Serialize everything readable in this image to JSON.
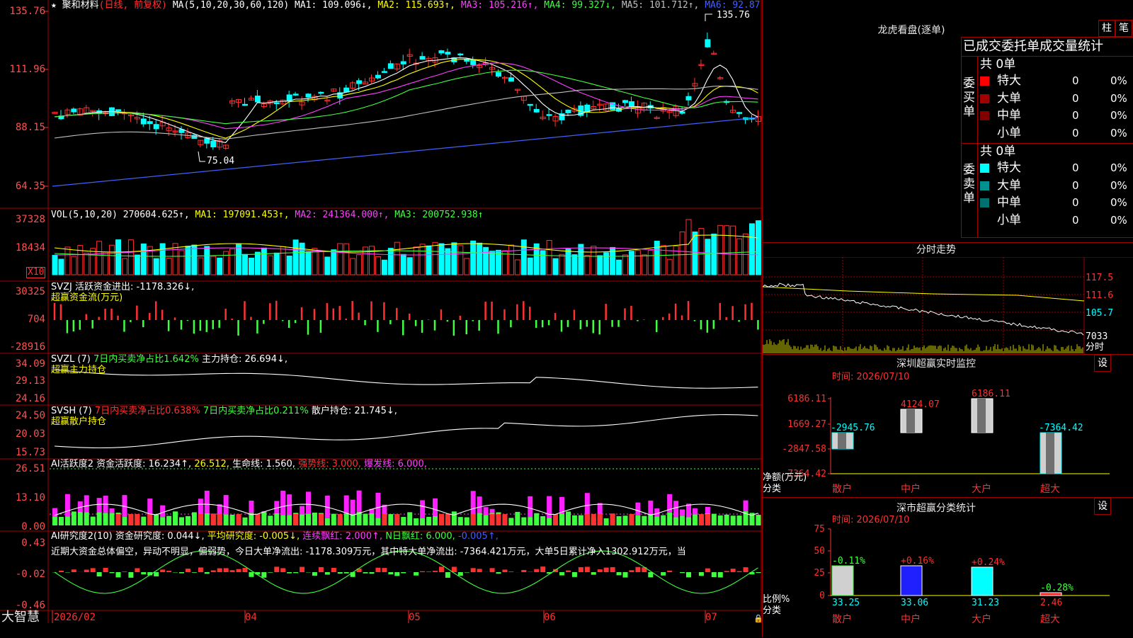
{
  "main": {
    "stock_name": "聚和材料",
    "period": "(日线, 前复权)",
    "ma_label": "MA(5,10,20,30,60,120)",
    "ma_items": [
      {
        "text": "MA1: 109.096↓,",
        "color": "#ffffff"
      },
      {
        "text": "MA2: 115.693↑,",
        "color": "#ffff00"
      },
      {
        "text": "MA3: 105.216↑,",
        "color": "#ff40ff"
      },
      {
        "text": "MA4: 99.327↓,",
        "color": "#40ff40"
      },
      {
        "text": "MA5: 101.712↑,",
        "color": "#c0c0c0"
      },
      {
        "text": "MA6: 92.87",
        "color": "#4060ff"
      }
    ],
    "y_labels": [
      "135.76",
      "111.96",
      "88.15",
      "64.35"
    ],
    "high_marker": "135.76",
    "low_marker": "75.04"
  },
  "vol": {
    "title": "VOL(5,10,20)",
    "value": "270604.625↑,",
    "ma_items": [
      {
        "text": "MA1: 197091.453↑,",
        "color": "#ffff00"
      },
      {
        "text": "MA2: 241364.000↑,",
        "color": "#ff40ff"
      },
      {
        "text": "MA3: 200752.938↑",
        "color": "#40ff40"
      }
    ],
    "y_labels": [
      "37328",
      "18434"
    ],
    "unit": "X10"
  },
  "svzj": {
    "title": "SVZJ  活跃资金进出: -1178.326↓,",
    "subtitle": "超赢资金流(万元)",
    "y_labels": [
      "30325",
      "704",
      "-28916"
    ]
  },
  "svzl": {
    "title_a": "SVZL (7)",
    "title_b": "7日内买卖净占比1.642%",
    "title_c": "主力持仓: 26.694↓,",
    "subtitle": "超赢主力持仓",
    "y_labels": [
      "34.09",
      "29.13",
      "24.16"
    ]
  },
  "svsh": {
    "title_a": "SVSH (7)",
    "title_b": "7日内买卖净占比0.638%",
    "title_c": "7日内买卖净占比0.211%",
    "title_d": "散户持仓: 21.745↓,",
    "subtitle": "超赢散户持仓",
    "y_labels": [
      "24.50",
      "20.03",
      "15.73"
    ]
  },
  "ai1": {
    "title": "AI活跃度2",
    "items": [
      {
        "text": "资金活跃度: 16.234↑,",
        "color": "#ffffff"
      },
      {
        "text": "26.512,",
        "color": "#ffff00"
      },
      {
        "text": "生命线: 1.560,",
        "color": "#ffffff"
      },
      {
        "text": "强势线: 3.000,",
        "color": "#ff3030"
      },
      {
        "text": "爆发线: 6.000,",
        "color": "#ff40ff"
      }
    ],
    "y_labels": [
      "26.51",
      "13.10",
      "0.00"
    ]
  },
  "ai2": {
    "title": "AI研究度2(10)",
    "items": [
      {
        "text": "资金研究度: 0.044↓,",
        "color": "#ffffff"
      },
      {
        "text": "平均研究度: -0.005↓,",
        "color": "#ffff00"
      },
      {
        "text": "连续飘红: 2.000↑,",
        "color": "#ff40ff"
      },
      {
        "text": "N日飘红: 6.000,",
        "color": "#40ff40"
      },
      {
        "text": "-0.005↑,",
        "color": "#4060ff"
      }
    ],
    "comment": "近期大资金总体偏空，异动不明显，偏弱势，今日大单净流出: -1178.309万元，其中特大单净流出: -7364.421万元，大单5日累计净入1302.912万元，当",
    "y_labels": [
      "0.43",
      "-0.02",
      "-0.46"
    ]
  },
  "footer": {
    "brand": "大智慧",
    "dates": [
      "2026/02",
      "04",
      "05",
      "06",
      "07"
    ]
  },
  "lhb": {
    "title": "龙虎看盘(逐单)",
    "btn_bar": "柱",
    "btn_pen": "笔",
    "subtitle": "已成交委托单成交量统计",
    "buy_label": "委买单",
    "sell_label": "委卖单",
    "buy_total": "共 0单",
    "sell_total": "共 0单",
    "rows_buy": [
      {
        "name": "特大",
        "count": "0",
        "pct": "0%",
        "color": "#ff0000"
      },
      {
        "name": "大单",
        "count": "0",
        "pct": "0%",
        "color": "#a00000"
      },
      {
        "name": "中单",
        "count": "0",
        "pct": "0%",
        "color": "#800000"
      },
      {
        "name": "小单",
        "count": "0",
        "pct": "0%",
        "color": ""
      }
    ],
    "rows_sell": [
      {
        "name": "特大",
        "count": "0",
        "pct": "0%",
        "color": "#00ffff"
      },
      {
        "name": "大单",
        "count": "0",
        "pct": "0%",
        "color": "#009090"
      },
      {
        "name": "中单",
        "count": "0",
        "pct": "0%",
        "color": "#007070"
      },
      {
        "name": "小单",
        "count": "0",
        "pct": "0%",
        "color": ""
      }
    ]
  },
  "intraday": {
    "title": "分时走势",
    "y_labels": [
      "117.5",
      "111.6",
      "105.7",
      "7033"
    ],
    "vol_label": "分时"
  },
  "sz_monitor": {
    "title": "深圳超赢实时监控",
    "settings": "设",
    "time": "时间: 2026/07/10",
    "y_labels": [
      "6186.11",
      "1669.27",
      "-2847.58",
      "-7364.42"
    ],
    "bar_labels": [
      "-2945.76",
      "4124.07",
      "6186.11",
      "-7364.42"
    ],
    "axis_title": "净额(万元)",
    "axis_sub": "分类",
    "categories": [
      "散户",
      "中户",
      "大户",
      "超大"
    ]
  },
  "sz_class": {
    "title": "深市超赢分类统计",
    "settings": "设",
    "time": "时间: 2026/07/10",
    "y_labels": [
      "75",
      "50",
      "25",
      "0"
    ],
    "change_labels": [
      "-0.11%",
      "+0.16%",
      "+0.24%",
      "-0.28%"
    ],
    "value_labels": [
      "33.25",
      "33.06",
      "31.23",
      "2.46"
    ],
    "axis_title": "比例%",
    "axis_sub": "分类",
    "categories": [
      "散户",
      "中户",
      "大户",
      "超大"
    ]
  },
  "colors": {
    "up": "#ff3030",
    "down": "#00ffff",
    "grid": "#a00000"
  }
}
